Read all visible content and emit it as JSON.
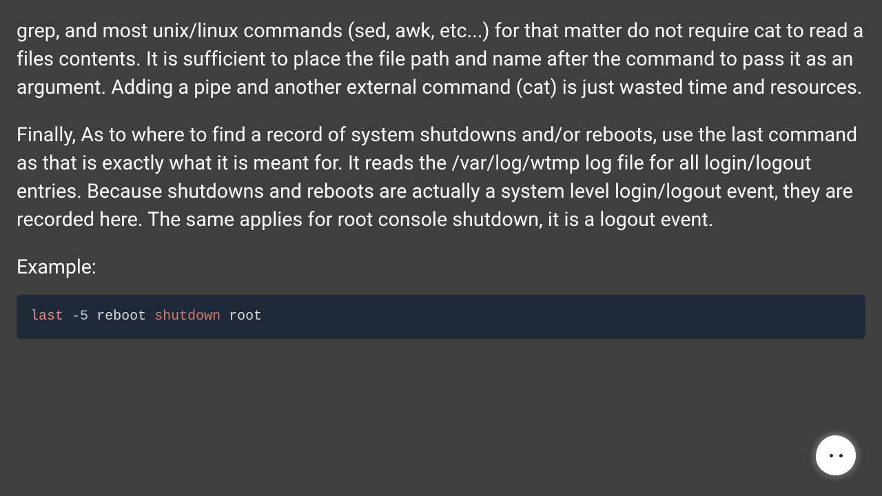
{
  "paragraphs": {
    "p1": "grep, and most unix/linux commands (sed, awk, etc...) for that matter do not require cat to read a files contents. It is sufficient to place the file path and name after the command to pass it as an argument. Adding a pipe and another external command (cat) is just wasted time and resources.",
    "p2": "Finally, As to where to find a record of system shutdowns and/or reboots, use the last command as that is exactly what it is meant for. It reads the /var/log/wtmp log file for all login/logout entries. Because shutdowns and reboots are actually a system level login/logout event, they are recorded here. The same applies for root console shutdown, it is a logout event.",
    "example_label": "Example:"
  },
  "code": {
    "t1": "last",
    "t2": " ",
    "t3": "-5",
    "t4": " ",
    "t5": "reboot",
    "t6": " ",
    "t7": "shutdown",
    "t8": " ",
    "t9": "root"
  },
  "fab": {
    "name": "chat-bubble"
  }
}
